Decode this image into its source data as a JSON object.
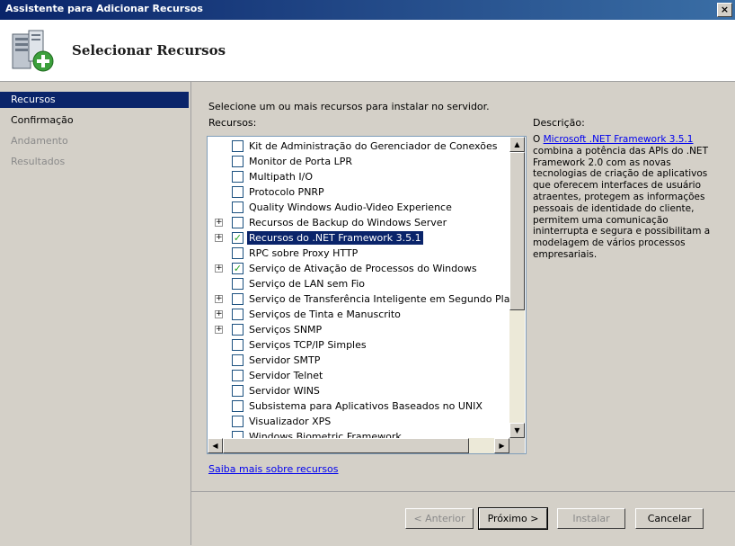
{
  "window": {
    "title": "Assistente para Adicionar Recursos",
    "close_label": "×"
  },
  "header": {
    "title": "Selecionar Recursos"
  },
  "steps": [
    {
      "label": "Recursos",
      "state": "active"
    },
    {
      "label": "Confirmação",
      "state": "done"
    },
    {
      "label": "Andamento",
      "state": "disabled"
    },
    {
      "label": "Resultados",
      "state": "disabled"
    }
  ],
  "main": {
    "instruction": "Selecione um ou mais recursos para instalar no servidor.",
    "features_label": "Recursos:",
    "description_label": "Descrição:",
    "features": [
      {
        "label": "Kit de Administração do Gerenciador de Conexões",
        "checked": false,
        "expandable": false,
        "selected": false
      },
      {
        "label": "Monitor de Porta LPR",
        "checked": false,
        "expandable": false,
        "selected": false
      },
      {
        "label": "Multipath I/O",
        "checked": false,
        "expandable": false,
        "selected": false
      },
      {
        "label": "Protocolo PNRP",
        "checked": false,
        "expandable": false,
        "selected": false
      },
      {
        "label": "Quality Windows Audio-Video Experience",
        "checked": false,
        "expandable": false,
        "selected": false
      },
      {
        "label": "Recursos de Backup do Windows Server",
        "checked": false,
        "expandable": true,
        "selected": false
      },
      {
        "label": "Recursos do .NET Framework 3.5.1",
        "checked": true,
        "expandable": true,
        "selected": true
      },
      {
        "label": "RPC sobre Proxy HTTP",
        "checked": false,
        "expandable": false,
        "selected": false
      },
      {
        "label": "Serviço de Ativação de Processos do Windows",
        "checked": true,
        "expandable": true,
        "selected": false
      },
      {
        "label": "Serviço de LAN sem Fio",
        "checked": false,
        "expandable": false,
        "selected": false
      },
      {
        "label": "Serviço de Transferência Inteligente em Segundo Plano (I",
        "checked": false,
        "expandable": true,
        "selected": false
      },
      {
        "label": "Serviços de Tinta e Manuscrito",
        "checked": false,
        "expandable": true,
        "selected": false
      },
      {
        "label": "Serviços SNMP",
        "checked": false,
        "expandable": true,
        "selected": false
      },
      {
        "label": "Serviços TCP/IP Simples",
        "checked": false,
        "expandable": false,
        "selected": false
      },
      {
        "label": "Servidor SMTP",
        "checked": false,
        "expandable": false,
        "selected": false
      },
      {
        "label": "Servidor Telnet",
        "checked": false,
        "expandable": false,
        "selected": false
      },
      {
        "label": "Servidor WINS",
        "checked": false,
        "expandable": false,
        "selected": false
      },
      {
        "label": "Subsistema para Aplicativos Baseados no UNIX",
        "checked": false,
        "expandable": false,
        "selected": false
      },
      {
        "label": "Visualizador XPS",
        "checked": false,
        "expandable": false,
        "selected": false
      },
      {
        "label": "Windows Biometric Framework",
        "checked": false,
        "expandable": false,
        "selected": false
      }
    ],
    "description": {
      "prefix": "O ",
      "link_text": "Microsoft .NET Framework 3.5.1",
      "body": " combina a potência das APIs do .NET Framework 2.0 com as novas tecnologias de criação de aplicativos que oferecem interfaces de usuário atraentes, protegem as informações pessoais de identidade do cliente, permitem uma comunicação ininterrupta e segura e possibilitam a modelagem de vários processos empresariais."
    },
    "learn_more": "Saiba mais sobre recursos"
  },
  "buttons": {
    "back": "< Anterior",
    "next": "Próximo >",
    "install": "Instalar",
    "cancel": "Cancelar"
  },
  "icons": {
    "header": "server-add-icon",
    "scroll_up": "▲",
    "scroll_down": "▼",
    "scroll_left": "◀",
    "scroll_right": "▶",
    "expand": "+",
    "check": "✓"
  }
}
